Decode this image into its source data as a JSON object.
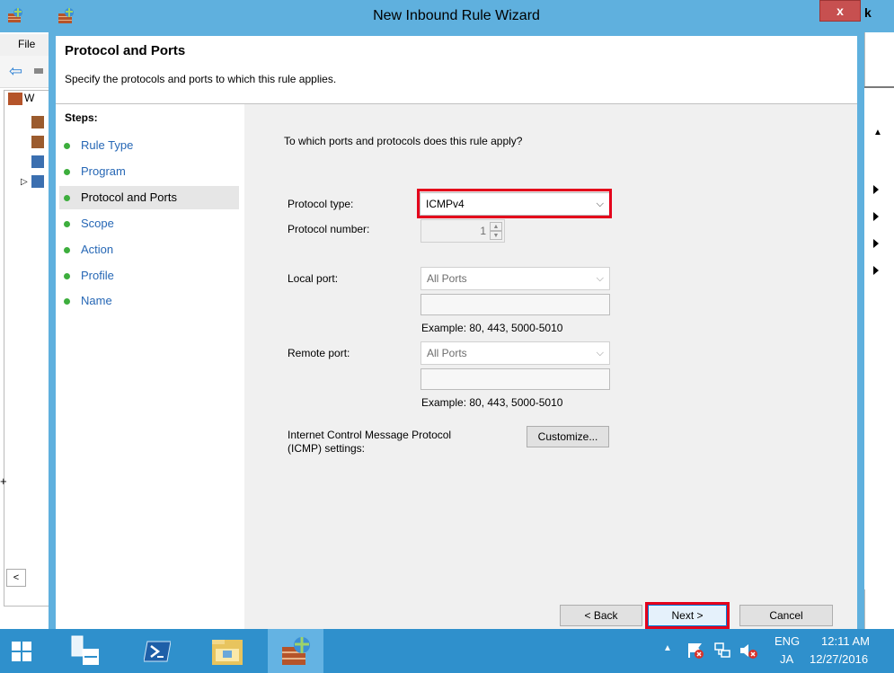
{
  "background": {
    "menu_file": "File",
    "tree_item_label": "W",
    "left_edge_glyph": "+"
  },
  "dialog": {
    "title": "New Inbound Rule Wizard",
    "close_glyph": "x",
    "header_title": "Protocol and Ports",
    "header_description": "Specify the protocols and ports to which this rule applies.",
    "steps_title": "Steps:",
    "steps": [
      {
        "label": "Rule Type"
      },
      {
        "label": "Program"
      },
      {
        "label": "Protocol and Ports"
      },
      {
        "label": "Scope"
      },
      {
        "label": "Action"
      },
      {
        "label": "Profile"
      },
      {
        "label": "Name"
      }
    ],
    "question": "To which ports and protocols does this rule apply?",
    "protocol_type_label": "Protocol type:",
    "protocol_type_value": "ICMPv4",
    "protocol_number_label": "Protocol number:",
    "protocol_number_value": "1",
    "local_port_label": "Local port:",
    "local_port_value": "All Ports",
    "local_port_example": "Example: 80, 443, 5000-5010",
    "remote_port_label": "Remote port:",
    "remote_port_value": "All Ports",
    "remote_port_example": "Example: 80, 443, 5000-5010",
    "icmp_label_line1": "Internet Control Message Protocol",
    "icmp_label_line2": "(ICMP) settings:",
    "customize_label": "Customize...",
    "back_label": "< Back",
    "next_label": "Next >",
    "cancel_label": "Cancel"
  },
  "taskbar": {
    "language": "ENG",
    "ime": "JA",
    "time": "12:11 AM",
    "date": "12/27/2016"
  },
  "colors": {
    "titlebar": "#5fb0de",
    "highlight": "#e4001b",
    "step_link": "#2667b5",
    "taskbar": "#2f90cc"
  }
}
